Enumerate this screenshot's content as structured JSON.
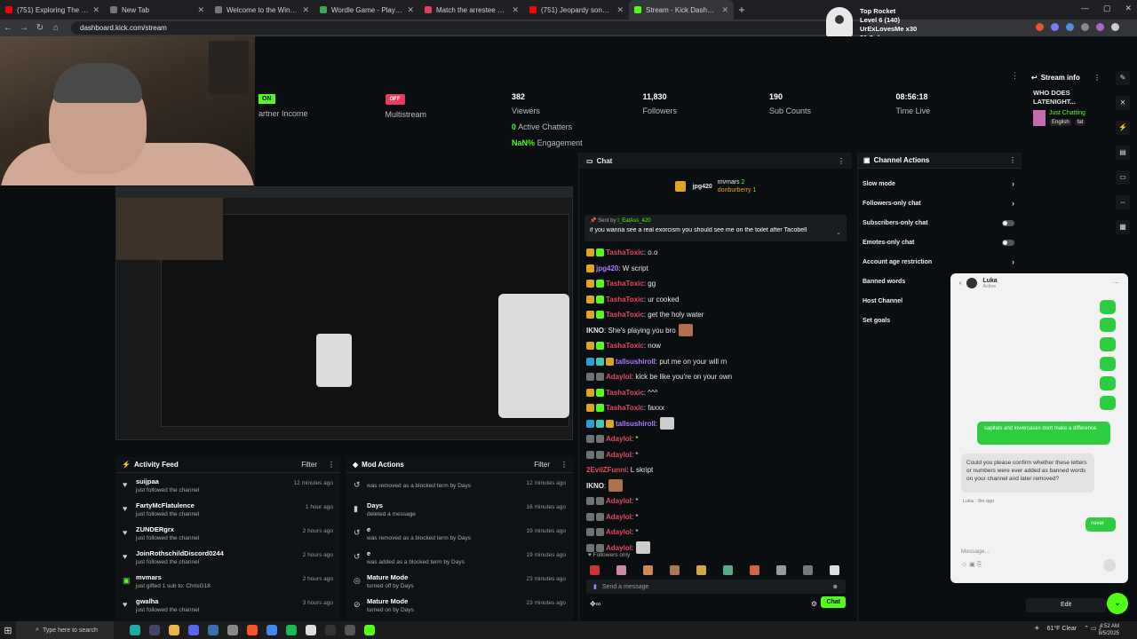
{
  "browser": {
    "tabs": [
      {
        "label": "(751) Exploring The Mystery Sp",
        "color": "#ff0000"
      },
      {
        "label": "New Tab",
        "color": "#777777"
      },
      {
        "label": "Welcome to the Winchester M",
        "color": "#777777"
      },
      {
        "label": "Wordle Game - Play Unlimited",
        "color": "#3aa757"
      },
      {
        "label": "Match the arrestee with their a",
        "color": "#e53e5a"
      },
      {
        "label": "(751) Jeopardy song 10 hours l",
        "color": "#ff0000"
      },
      {
        "label": "Stream - Kick Dashboard",
        "color": "#53fc18"
      }
    ],
    "url": "dashboard.kick.com/stream"
  },
  "overlay": {
    "title": "Top Rocket",
    "level": "Level 6 (140)",
    "user": "UrExLovesMe x30",
    "subs": "31 Subs"
  },
  "stats": {
    "partner_badge": "ON",
    "partner_label": "artner Income",
    "multistream_badge": "OFF",
    "multistream_label": "Multistream",
    "viewers_value": "382",
    "viewers_label": "Viewers",
    "chatters_value": "0",
    "chatters_label": "Active Chatters",
    "engagement_value": "NaN%",
    "engagement_label": "Engagement",
    "followers_value": "11,830",
    "followers_label": "Followers",
    "subs_value": "190",
    "subs_label": "Sub Counts",
    "time_value": "08:56:18",
    "time_label": "Time Live"
  },
  "stream_info": {
    "title": "Stream info",
    "stream_title": "WHO DOES LATENIGHT...",
    "category": "Just Chatting",
    "tags": [
      "English",
      "fat"
    ]
  },
  "activity_feed": {
    "title": "Activity Feed",
    "filter": "Filter",
    "items": [
      {
        "name": "suijpaa",
        "sub": "just followed the channel",
        "time": "12 minutes ago"
      },
      {
        "name": "FartyMcFlatulence",
        "sub": "just followed the channel",
        "time": "1 hour ago"
      },
      {
        "name": "ZUNDERgrx",
        "sub": "just followed the channel",
        "time": "2 hours ago"
      },
      {
        "name": "JoinRothschildDiscord0244",
        "sub": "just followed the channel",
        "time": "2 hours ago"
      },
      {
        "name": "mvmars",
        "sub": "just gifted 1 sub to: ChrisG18",
        "time": "2 hours ago"
      },
      {
        "name": "gwalha",
        "sub": "just followed the channel",
        "time": "3 hours ago"
      }
    ]
  },
  "mod_actions": {
    "title": "Mod Actions",
    "filter": "Filter",
    "items": [
      {
        "name": "",
        "sub": "was removed as a blocked term by Days",
        "time": "12 minutes ago"
      },
      {
        "name": "Days",
        "sub": "deleted a message",
        "time": "16 minutes ago"
      },
      {
        "name": "e",
        "sub": "was removed as a blocked term by Days",
        "time": "19 minutes ago"
      },
      {
        "name": "e",
        "sub": "was added as a blocked term by Days",
        "time": "19 minutes ago"
      },
      {
        "name": "Mature Mode",
        "sub": "turned off by Days",
        "time": "23 minutes ago"
      },
      {
        "name": "Mature Mode",
        "sub": "turned on by Days",
        "time": "23 minutes ago"
      }
    ]
  },
  "chat": {
    "title": "Chat",
    "leaders": [
      {
        "name": "jpg420",
        "count": ""
      },
      {
        "name": "mvmars",
        "count": "2"
      },
      {
        "name": "donburberry",
        "count": "1"
      }
    ],
    "pinned_by": "Sent by",
    "pinned_user": "I_EatAss_420",
    "pinned_msg": "if you wanna see a real exorcism you should see me on the toilet after Tacobell",
    "messages": [
      {
        "user": "TashaToxic",
        "text": ": o.o",
        "color": "u-red",
        "badges": [
          "b-gold",
          "b-green"
        ]
      },
      {
        "user": "jpg420",
        "text": ": W script",
        "color": "u-purple",
        "badges": [
          "b-gold"
        ]
      },
      {
        "user": "TashaToxic",
        "text": ": gg",
        "color": "u-red",
        "badges": [
          "b-gold",
          "b-green"
        ]
      },
      {
        "user": "TashaToxic",
        "text": ": ur cooked",
        "color": "u-red",
        "badges": [
          "b-gold",
          "b-green"
        ]
      },
      {
        "user": "TashaToxic",
        "text": ": get the holy water",
        "color": "u-red",
        "badges": [
          "b-gold",
          "b-green"
        ]
      },
      {
        "user": "IKNO",
        "text": ": She's playing you bro",
        "color": "u-white",
        "badges": []
      },
      {
        "user": "TashaToxic",
        "text": ": now",
        "color": "u-red",
        "badges": [
          "b-gold",
          "b-green"
        ]
      },
      {
        "user": "tallsushiroll",
        "text": ": put me on your will rn",
        "color": "u-purple",
        "badges": [
          "b-blue",
          "b-teal",
          "b-gold"
        ]
      },
      {
        "user": "Adaylol",
        "text": ": kick be like you're on your own",
        "color": "u-red",
        "badges": [
          "b-grey",
          "b-grey"
        ]
      },
      {
        "user": "TashaToxic",
        "text": ": ^^^",
        "color": "u-red",
        "badges": [
          "b-gold",
          "b-green"
        ]
      },
      {
        "user": "TashaToxic",
        "text": ": faxxx",
        "color": "u-red",
        "badges": [
          "b-gold",
          "b-green"
        ]
      },
      {
        "user": "tallsushiroll",
        "text": ":",
        "color": "u-purple",
        "badges": [
          "b-blue",
          "b-teal",
          "b-gold"
        ]
      },
      {
        "user": "Adaylol",
        "text": ": *",
        "color": "u-red",
        "badges": [
          "b-grey",
          "b-grey"
        ]
      },
      {
        "user": "Adaylol",
        "text": ": *",
        "color": "u-red",
        "badges": [
          "b-grey",
          "b-grey"
        ]
      },
      {
        "user": "2EvilZFunni",
        "text": ": L skript",
        "color": "u-red",
        "badges": []
      },
      {
        "user": "IKNO",
        "text": ":",
        "color": "u-white",
        "badges": []
      },
      {
        "user": "Adaylol",
        "text": ": *",
        "color": "u-red",
        "badges": [
          "b-grey",
          "b-grey"
        ]
      },
      {
        "user": "Adaylol",
        "text": ": *",
        "color": "u-red",
        "badges": [
          "b-grey",
          "b-grey"
        ]
      },
      {
        "user": "Adaylol",
        "text": ": *",
        "color": "u-red",
        "badges": [
          "b-grey",
          "b-grey"
        ]
      },
      {
        "user": "Adaylol",
        "text": ":",
        "color": "u-red",
        "badges": [
          "b-grey",
          "b-grey"
        ]
      }
    ],
    "followers_only": "Followers only",
    "send_placeholder": "Send a message",
    "chat_button": "Chat"
  },
  "channel_actions": {
    "title": "Channel Actions",
    "items": [
      {
        "label": "Slow mode",
        "control": "chevron"
      },
      {
        "label": "Followers-only chat",
        "control": "chevron"
      },
      {
        "label": "Subscribers-only chat",
        "control": "toggle"
      },
      {
        "label": "Emotes-only chat",
        "control": "toggle"
      },
      {
        "label": "Account age restriction",
        "control": "chevron"
      },
      {
        "label": "Banned words",
        "control": "none"
      },
      {
        "label": "Host Channel",
        "control": "none"
      },
      {
        "label": "Set goals",
        "control": "none"
      }
    ]
  },
  "dm": {
    "name": "Luka",
    "status": "Active",
    "outgoing_text": "capitals and lowercases dont make a difference",
    "incoming_text": "Could you please confirm whether these letters or numbers were ever added as banned words on your channel and later removed?",
    "incoming_meta": "Luka · 9m ago",
    "reply": "never",
    "input_placeholder": "Message..."
  },
  "edit_button": "Edit",
  "taskbar": {
    "search_placeholder": "Type here to search",
    "weather": "61°F Clear",
    "time": "4:52 AM",
    "date": "8/5/2025"
  }
}
